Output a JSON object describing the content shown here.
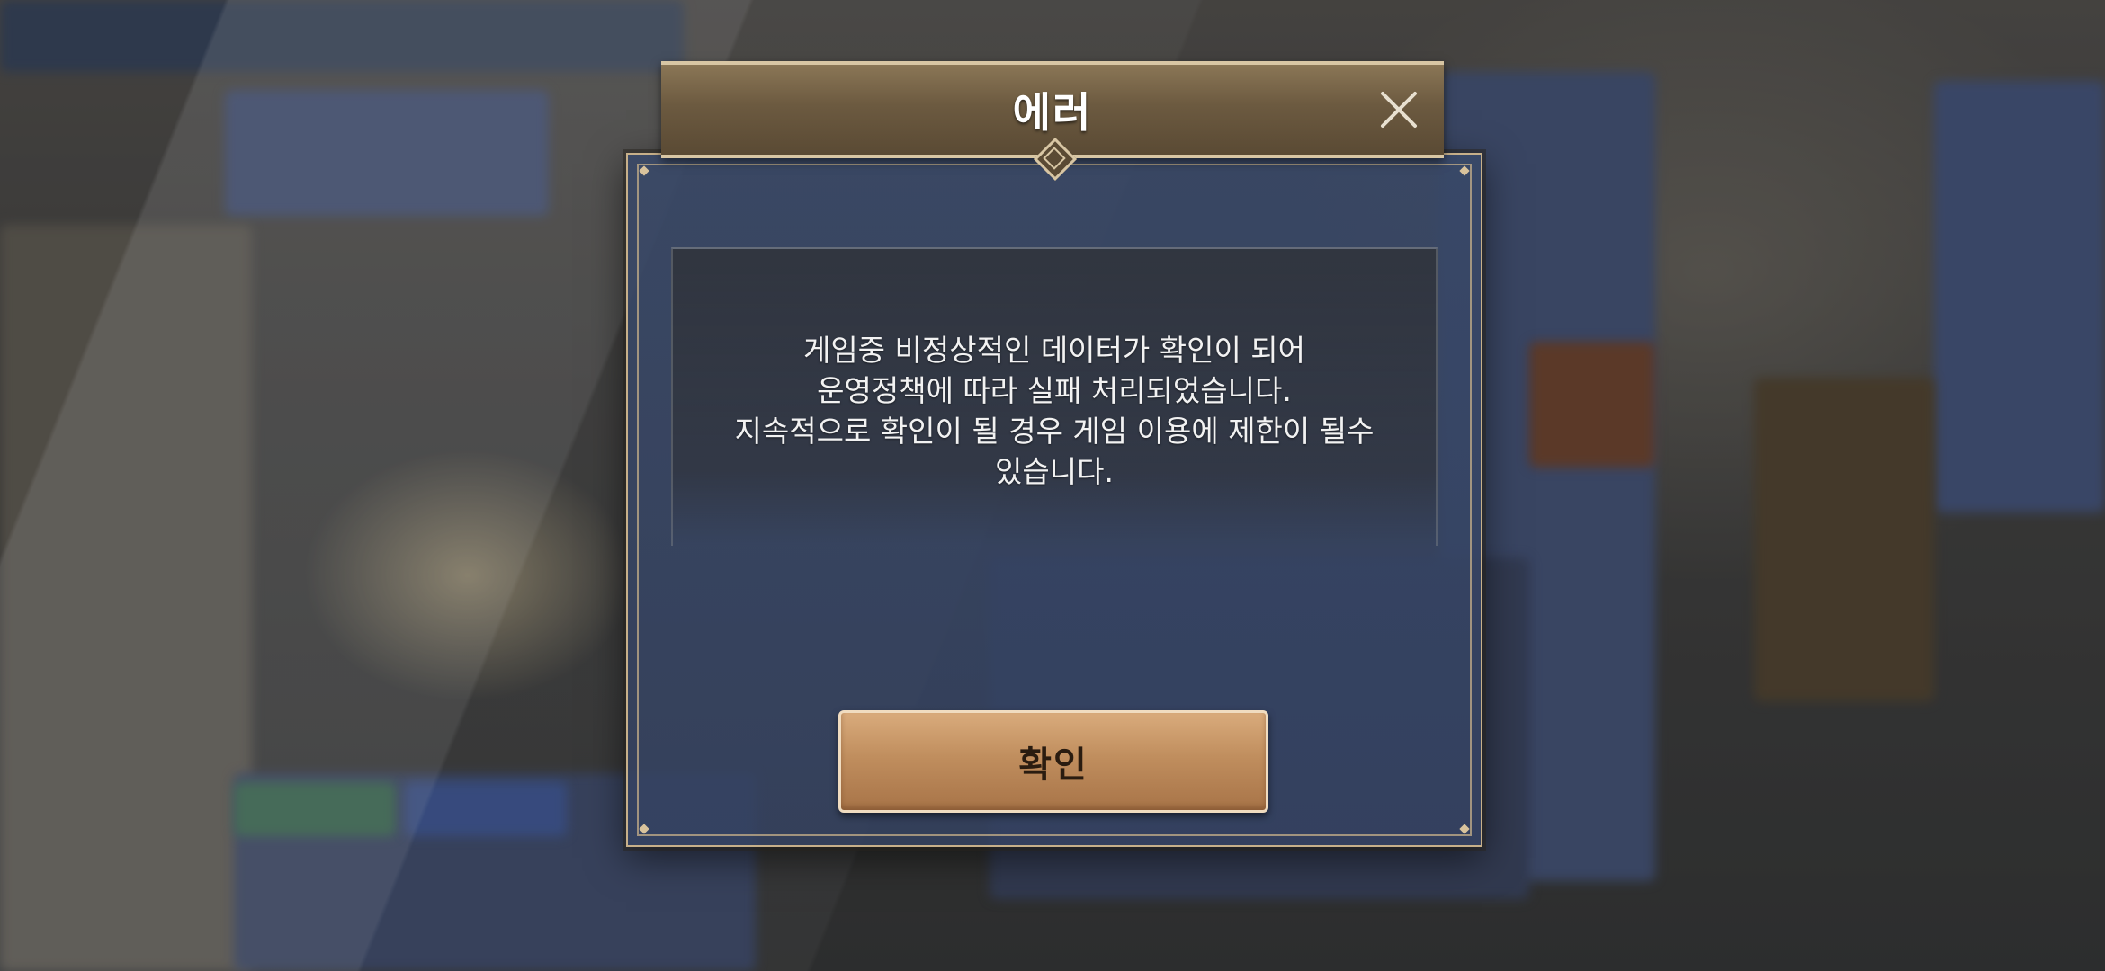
{
  "dialog": {
    "title": "에러",
    "message": "게임중 비정상적인 데이터가 확인이 되어\n운영정책에 따라 실패 처리되었습니다.\n지속적으로 확인이 될 경우 게임 이용에 제한이 될수\n있습니다.",
    "confirm_label": "확인",
    "close_icon": "close-icon"
  },
  "colors": {
    "title_bar": "#6c5a40",
    "frame_gold": "#c7b08a",
    "panel_blue": "#384868",
    "button_bronze": "#c08e5e"
  }
}
